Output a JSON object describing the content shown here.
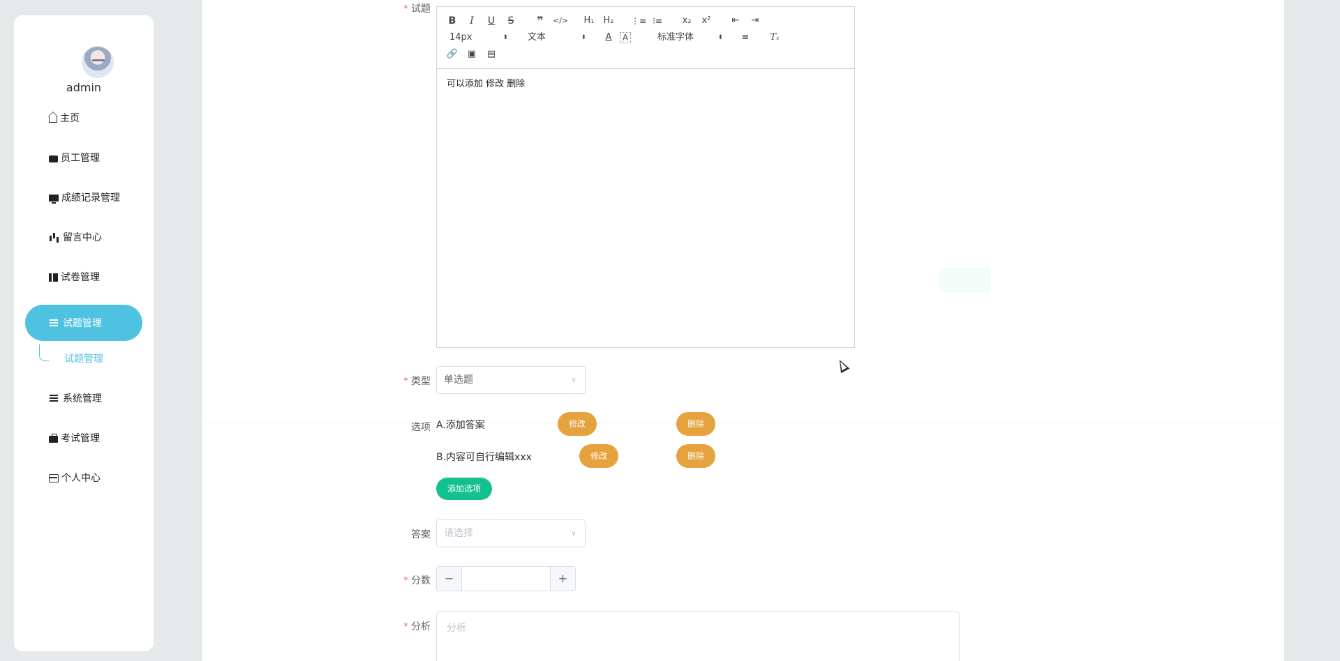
{
  "user": {
    "name": "admin"
  },
  "sidebar": {
    "items": [
      {
        "label": "主页",
        "icon": "home-icon"
      },
      {
        "label": "员工管理",
        "icon": "wallet-icon"
      },
      {
        "label": "成绩记录管理",
        "icon": "monitor-icon"
      },
      {
        "label": "留言中心",
        "icon": "bar-chart-icon"
      },
      {
        "label": "试卷管理",
        "icon": "book-icon"
      },
      {
        "label": "试题管理",
        "icon": "list-icon",
        "active": true
      },
      {
        "label": "系统管理",
        "icon": "list-icon"
      },
      {
        "label": "考试管理",
        "icon": "briefcase-icon"
      },
      {
        "label": "个人中心",
        "icon": "card-icon"
      }
    ],
    "subitem": "试题管理"
  },
  "form": {
    "question_label": "试题",
    "editor": {
      "font_size": "14px",
      "paragraph": "文本",
      "font_family": "标准字体",
      "content": "可以添加 修改 删除"
    },
    "type_label": "类型",
    "type_value": "单选题",
    "options_label": "选项",
    "options": [
      {
        "text": "A.添加答案",
        "edit": "修改",
        "delete": "删除"
      },
      {
        "text": "B.内容可自行编辑xxx",
        "edit": "修改",
        "delete": "删除"
      }
    ],
    "add_option": "添加选项",
    "answer_label": "答案",
    "answer_placeholder": "请选择",
    "score_label": "分数",
    "stepper_minus": "−",
    "stepper_plus": "+",
    "analysis_label": "分析",
    "analysis_placeholder": "分析"
  },
  "colors": {
    "accent": "#4ec2e0",
    "warning": "#e6a23c",
    "success": "#13c08f",
    "required": "#f56c6c"
  }
}
